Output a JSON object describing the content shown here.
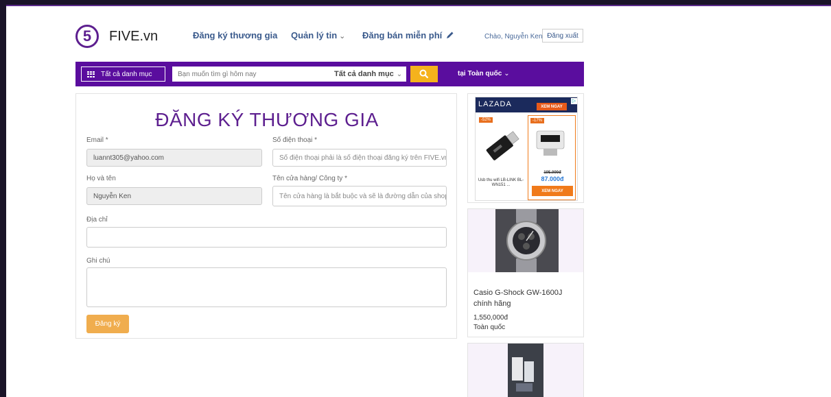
{
  "header": {
    "logo_digit": "5",
    "logo_text": "FIVE.vn",
    "nav": [
      {
        "label": "Đăng ký thương gia"
      },
      {
        "label": "Quản lý tin",
        "dropdown": true
      },
      {
        "label": "Đăng bán miễn phí",
        "icon": "pencil-icon"
      }
    ],
    "greeting": "Chào, Nguyễn Ken",
    "logout_label": "Đăng xuất"
  },
  "searchbar": {
    "all_categories_label": "Tất cả danh mục",
    "search_placeholder": "Bạn muốn tìm gì hôm nay",
    "category_select": "Tất cả danh mục",
    "search_icon": "search-icon",
    "region_label": "tại Toàn quốc"
  },
  "form": {
    "title": "ĐĂNG KÝ THƯƠNG GIA",
    "email_label": "Email *",
    "email_value": "luannt305@yahoo.com",
    "phone_label": "Số điện thoại *",
    "phone_placeholder": "Số điện thoại phải là số điện thoại đăng ký trên FIVE.vn",
    "name_label": "Họ và tên",
    "name_value": "Nguyễn Ken",
    "shop_label": "Tên cửa hàng/ Công ty *",
    "shop_placeholder": "Tên cửa hàng là bắt buộc và sẽ là đường dẫn của shop",
    "address_label": "Địa chỉ",
    "address_value": "",
    "note_label": "Ghi chú",
    "note_value": "",
    "submit_label": "Đăng ký"
  },
  "ad": {
    "brand": "LAZADA",
    "cta": "XEM NGAY",
    "items": [
      {
        "discount": "-52%",
        "name": "Usb thu wifi LB-LINK BL-WN151 ..."
      },
      {
        "discount": "-17%",
        "old_price": "105.000đ",
        "new_price": "87.000đ",
        "buy_label": "XEM NGAY"
      }
    ]
  },
  "products": [
    {
      "title": "Casio G-Shock GW-1600J chính hãng",
      "price": "1,550,000đ",
      "location": "Toàn quốc"
    }
  ],
  "colors": {
    "brand_purple": "#5a0d9e",
    "accent_yellow": "#f5b21c",
    "submit_orange": "#f0ad4e",
    "nav_blue": "#3a5a8c"
  }
}
